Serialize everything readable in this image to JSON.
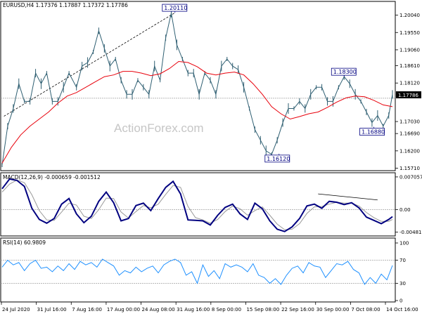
{
  "watermark": "ActionForex.com",
  "colors": {
    "background": "#ffffff",
    "price": "#2f5f72",
    "moving_average": "#e8000b",
    "macd": "#000080",
    "macd_signal": "#9a9a9a",
    "rsi": "#1e90ff",
    "level": "#a0a0a0",
    "annotation": "#000080"
  },
  "chart_data": [
    {
      "type": "line",
      "panel": "price",
      "title": "EURUSD,H4  1.17376 1.17887 1.17372 1.17786",
      "current_price": "1.17786",
      "y_ticks": [
        "1.20040",
        "1.19550",
        "1.19060",
        "1.18610",
        "1.18120",
        "1.17030",
        "1.16690",
        "1.16200",
        "1.15710"
      ],
      "ylim": [
        1.1566,
        1.2041
      ],
      "series": [
        {
          "role": "price",
          "x": [
            0,
            3,
            6,
            9,
            12,
            15,
            18,
            21,
            24,
            27,
            30,
            33,
            36,
            40,
            43,
            46,
            49,
            52,
            55,
            58,
            61,
            64,
            67,
            70,
            73,
            76,
            79,
            82,
            85,
            88,
            91,
            94,
            97,
            100,
            103,
            106,
            109,
            112,
            115,
            118,
            121,
            124,
            127,
            130,
            133,
            136,
            139,
            142,
            145,
            148,
            151,
            154,
            157,
            160,
            163,
            166,
            169,
            172,
            175,
            178,
            181,
            184,
            187,
            190,
            193,
            196,
            199,
            202,
            205,
            208,
            210
          ],
          "y": [
            1.158,
            1.169,
            1.174,
            1.181,
            1.176,
            1.176,
            1.184,
            1.181,
            1.184,
            1.176,
            1.176,
            1.18,
            1.184,
            1.18,
            1.186,
            1.187,
            1.19,
            1.196,
            1.191,
            1.186,
            1.188,
            1.182,
            1.178,
            1.178,
            1.182,
            1.18,
            1.178,
            1.186,
            1.182,
            1.194,
            1.201,
            1.192,
            1.188,
            1.184,
            1.184,
            1.178,
            1.184,
            1.182,
            1.178,
            1.186,
            1.188,
            1.186,
            1.185,
            1.18,
            1.174,
            1.168,
            1.165,
            1.162,
            1.161,
            1.165,
            1.17,
            1.174,
            1.174,
            1.176,
            1.174,
            1.178,
            1.18,
            1.18,
            1.176,
            1.176,
            1.18,
            1.183,
            1.181,
            1.178,
            1.176,
            1.173,
            1.17,
            1.172,
            1.169,
            1.172,
            1.178
          ]
        },
        {
          "role": "moving_average",
          "x": [
            0,
            5,
            10,
            15,
            20,
            25,
            30,
            35,
            40,
            45,
            50,
            55,
            60,
            65,
            70,
            75,
            80,
            85,
            90,
            95,
            100,
            105,
            110,
            115,
            120,
            125,
            130,
            135,
            140,
            145,
            150,
            155,
            160,
            165,
            170,
            175,
            180,
            185,
            190,
            195,
            200,
            205,
            210
          ],
          "y": [
            1.1585,
            1.163,
            1.1665,
            1.169,
            1.171,
            1.173,
            1.1755,
            1.1775,
            1.1785,
            1.18,
            1.1815,
            1.183,
            1.1835,
            1.1845,
            1.1845,
            1.184,
            1.1833,
            1.1838,
            1.1853,
            1.1873,
            1.187,
            1.1858,
            1.184,
            1.1835,
            1.184,
            1.1843,
            1.1835,
            1.181,
            1.178,
            1.1745,
            1.1725,
            1.171,
            1.1717,
            1.1725,
            1.173,
            1.1743,
            1.1758,
            1.177,
            1.1775,
            1.1773,
            1.1763,
            1.175,
            1.1745
          ]
        }
      ],
      "horizontal_level": 1.1769,
      "trend_line": {
        "from": {
          "x": 1,
          "y": 1.1718
        },
        "to": {
          "x": 93,
          "y": 1.2011
        }
      },
      "annotations": [
        {
          "label": "1.20110",
          "x": 93,
          "y": 1.2011
        },
        {
          "label": "1.18300",
          "x": 184,
          "y": 1.183
        },
        {
          "label": "1.16880",
          "x": 200,
          "y": 1.1688
        },
        {
          "label": "1.16120",
          "x": 149,
          "y": 1.1612
        }
      ]
    },
    {
      "type": "line",
      "panel": "macd",
      "title": "MACD(12,26,9) -0.000659 -0.001512",
      "y_ticks": [
        "0.007057",
        "0.00",
        "-0.004818"
      ],
      "ylim": [
        -0.0055,
        0.0078
      ],
      "series": [
        {
          "role": "macd",
          "x": [
            0,
            4,
            8,
            12,
            16,
            20,
            24,
            28,
            32,
            36,
            40,
            44,
            48,
            52,
            56,
            60,
            64,
            68,
            72,
            76,
            80,
            84,
            88,
            92,
            96,
            100,
            104,
            108,
            112,
            116,
            120,
            124,
            128,
            132,
            136,
            140,
            144,
            148,
            152,
            156,
            160,
            164,
            168,
            172,
            176,
            180,
            184,
            188,
            192,
            196,
            200,
            204,
            208,
            210
          ],
          "y": [
            0.0045,
            0.0066,
            0.0063,
            0.005,
            0.0003,
            -0.0021,
            -0.0029,
            -0.0019,
            0.0012,
            0.0024,
            -0.0009,
            -0.0028,
            -0.0014,
            0.0018,
            0.0038,
            0.0015,
            -0.0024,
            -0.0019,
            0.0009,
            0.0014,
            -0.0002,
            0.0024,
            0.0048,
            0.0061,
            0.0034,
            -0.0022,
            -0.0023,
            -0.0024,
            -0.0033,
            -0.0012,
            0.0005,
            0.0012,
            -0.0009,
            -0.0021,
            0.0014,
            0.0002,
            -0.0024,
            -0.0042,
            -0.0047,
            -0.0037,
            -0.0019,
            0.0008,
            0.0012,
            0.0003,
            0.0018,
            0.0016,
            0.0011,
            0.0015,
            0.0004,
            -0.0016,
            -0.0023,
            -0.003,
            -0.0021,
            -0.0015
          ]
        },
        {
          "role": "signal",
          "x": [
            0,
            4,
            8,
            12,
            16,
            20,
            24,
            28,
            32,
            36,
            40,
            44,
            48,
            52,
            56,
            60,
            64,
            68,
            72,
            76,
            80,
            84,
            88,
            92,
            96,
            100,
            104,
            108,
            112,
            116,
            120,
            124,
            128,
            132,
            136,
            140,
            144,
            148,
            152,
            156,
            160,
            164,
            168,
            172,
            176,
            180,
            184,
            188,
            192,
            196,
            200,
            204,
            208,
            210
          ],
          "y": [
            0.0038,
            0.0055,
            0.0064,
            0.0058,
            0.0032,
            -0.0002,
            -0.0022,
            -0.0023,
            -0.0005,
            0.0014,
            0.001,
            -0.0014,
            -0.0019,
            0.0,
            0.0025,
            0.0024,
            -0.0005,
            -0.0018,
            -0.0004,
            0.0009,
            0.0004,
            0.0012,
            0.0033,
            0.0052,
            0.0048,
            0.0007,
            -0.0017,
            -0.0022,
            -0.0029,
            -0.0021,
            -0.0004,
            0.0008,
            0.0002,
            -0.0012,
            -0.0002,
            0.0006,
            -0.0012,
            -0.0031,
            -0.0043,
            -0.0042,
            -0.003,
            -0.0008,
            0.0006,
            0.0007,
            0.0012,
            0.0016,
            0.0014,
            0.0014,
            0.0008,
            -0.0006,
            -0.0017,
            -0.0025,
            -0.0025,
            -0.0021
          ]
        }
      ],
      "divergence_line": {
        "from": {
          "x": 170,
          "y": 0.0034
        },
        "to": {
          "x": 202,
          "y": 0.0021
        }
      }
    },
    {
      "type": "line",
      "panel": "rsi",
      "title": "RSI(14) 60.9809",
      "y_ticks": [
        "100",
        "70",
        "30",
        "0"
      ],
      "ylim": [
        0,
        100
      ],
      "levels": [
        70,
        30
      ],
      "series": [
        {
          "role": "rsi",
          "x": [
            0,
            3,
            6,
            9,
            12,
            15,
            18,
            21,
            24,
            27,
            30,
            33,
            36,
            39,
            42,
            45,
            48,
            51,
            54,
            57,
            60,
            63,
            66,
            69,
            72,
            75,
            78,
            81,
            84,
            87,
            90,
            93,
            96,
            99,
            102,
            105,
            108,
            111,
            114,
            117,
            120,
            123,
            126,
            129,
            132,
            135,
            138,
            141,
            144,
            147,
            150,
            153,
            156,
            159,
            162,
            165,
            168,
            171,
            174,
            177,
            180,
            183,
            186,
            189,
            192,
            195,
            198,
            201,
            204,
            207,
            210
          ],
          "y": [
            58,
            70,
            62,
            66,
            52,
            64,
            70,
            56,
            58,
            50,
            60,
            52,
            64,
            54,
            68,
            62,
            66,
            58,
            72,
            66,
            60,
            44,
            52,
            48,
            58,
            50,
            56,
            60,
            48,
            62,
            68,
            72,
            66,
            44,
            50,
            30,
            62,
            42,
            52,
            38,
            64,
            58,
            62,
            58,
            50,
            64,
            44,
            40,
            30,
            38,
            28,
            44,
            56,
            60,
            48,
            66,
            60,
            58,
            40,
            52,
            64,
            62,
            68,
            54,
            48,
            28,
            40,
            30,
            46,
            36,
            61
          ]
        }
      ]
    }
  ],
  "x_axis_labels": [
    "24 Jul 2020",
    "31 Jul 16:00",
    "7 Aug 16:00",
    "17 Aug 00:00",
    "24 Aug 08:00",
    "31 Aug 16:00",
    "8 Sep 00:00",
    "15 Sep 08:00",
    "22 Sep 16:00",
    "30 Sep 00:00",
    "7 Oct 08:00",
    "14 Oct 16:00"
  ]
}
